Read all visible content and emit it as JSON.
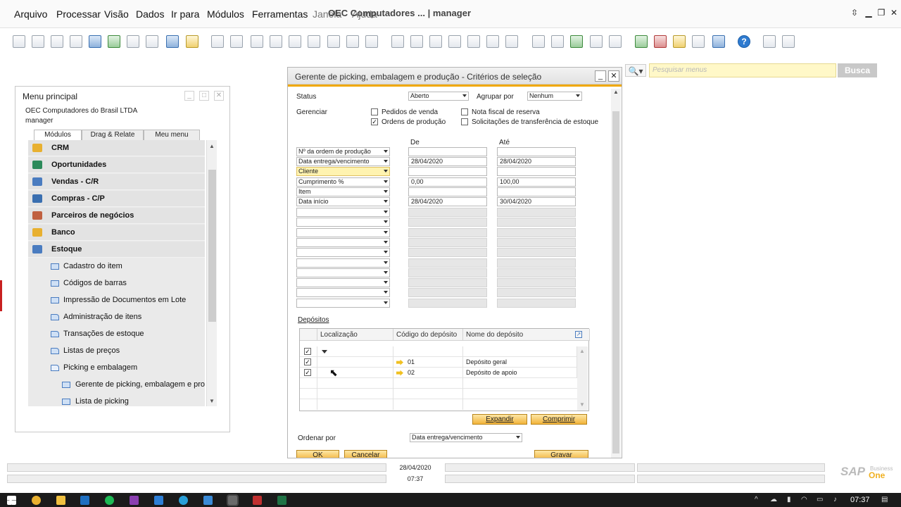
{
  "app": {
    "title": "OEC Computadores ... | manager",
    "menu": [
      "Arquivo",
      "Processar",
      "Visão",
      "Dados",
      "Ir para",
      "Módulos",
      "Ferramentas",
      "Janela",
      "Ajuda"
    ]
  },
  "search": {
    "placeholder": "Pesquisar menus",
    "button": "Busca"
  },
  "main_menu": {
    "title": "Menu principal",
    "company": "OEC Computadores do Brasil LTDA",
    "user": "manager",
    "tabs": [
      "Módulos",
      "Drag & Relate",
      "Meu menu"
    ],
    "modules": [
      {
        "label": "CRM",
        "icon": "crm-icon",
        "color": "#e8b030"
      },
      {
        "label": "Oportunidades",
        "icon": "opportunities-icon",
        "color": "#2c8a5a"
      },
      {
        "label": "Vendas - C/R",
        "icon": "sales-icon",
        "color": "#4a7cc0"
      },
      {
        "label": "Compras - C/P",
        "icon": "purchasing-icon",
        "color": "#3a6fb0"
      },
      {
        "label": "Parceiros de negócios",
        "icon": "business-partners-icon",
        "color": "#c06040"
      },
      {
        "label": "Banco",
        "icon": "bank-icon",
        "color": "#e8b030"
      },
      {
        "label": "Estoque",
        "icon": "inventory-icon",
        "color": "#4a7cc0"
      }
    ],
    "subitems": [
      {
        "label": "Cadastro do item",
        "level": 1
      },
      {
        "label": "Códigos de barras",
        "level": 1
      },
      {
        "label": "Impressão de Documentos em Lote",
        "level": 1
      },
      {
        "label": "Administração de itens",
        "level": 1
      },
      {
        "label": "Transações de estoque",
        "level": 1
      },
      {
        "label": "Listas de preços",
        "level": 1
      },
      {
        "label": "Picking e embalagem",
        "level": 1
      },
      {
        "label": "Gerente de picking, embalagem e produção",
        "level": 2
      },
      {
        "label": "Lista de picking",
        "level": 2
      }
    ]
  },
  "dialog": {
    "title": "Gerente de picking, embalagem e produção - Critérios de seleção",
    "status_label": "Status",
    "status_value": "Aberto",
    "group_label": "Agrupar por",
    "group_value": "Nenhum",
    "manage_label": "Gerenciar",
    "checks": {
      "pedidos": {
        "label": "Pedidos de venda",
        "checked": false
      },
      "ordens": {
        "label": "Ordens de produção",
        "checked": true
      },
      "nota": {
        "label": "Nota fiscal de reserva",
        "checked": false
      },
      "solic": {
        "label": "Solicitações de transferência de estoque",
        "checked": false
      }
    },
    "col_from": "De",
    "col_to": "Até",
    "criteria": [
      {
        "field": "Nº da ordem de produção",
        "from": "",
        "to": "",
        "highlight": false
      },
      {
        "field": "Data entrega/vencimento",
        "from": "28/04/2020",
        "to": "28/04/2020",
        "highlight": false
      },
      {
        "field": "Cliente",
        "from": "",
        "to": "",
        "highlight": true
      },
      {
        "field": "Cumprimento %",
        "from": "0,00",
        "to": "100,00",
        "highlight": false
      },
      {
        "field": "Item",
        "from": "",
        "to": "",
        "highlight": false
      },
      {
        "field": "Data início",
        "from": "28/04/2020",
        "to": "30/04/2020",
        "highlight": false
      }
    ],
    "empty_rows": 10,
    "deposits_label": "Depósitos",
    "grid_headers": [
      "Localização",
      "Código do depósito",
      "Nome do depósito"
    ],
    "deposits": [
      {
        "code": "01",
        "name": "Depósito geral",
        "checked": true
      },
      {
        "code": "02",
        "name": "Depósito de apoio",
        "checked": true
      }
    ],
    "expand_btn": "Expandir",
    "collapse_btn": "Comprimir",
    "order_label": "Ordenar por",
    "order_value": "Data entrega/vencimento",
    "ok_btn": "OK",
    "cancel_btn": "Cancelar",
    "save_btn": "Gravar"
  },
  "status_bar": {
    "date": "28/04/2020",
    "time": "07:37"
  },
  "sap_logo": {
    "brand": "SAP",
    "line1": "Business",
    "line2": "One"
  },
  "taskbar": {
    "clock": "07:37"
  }
}
